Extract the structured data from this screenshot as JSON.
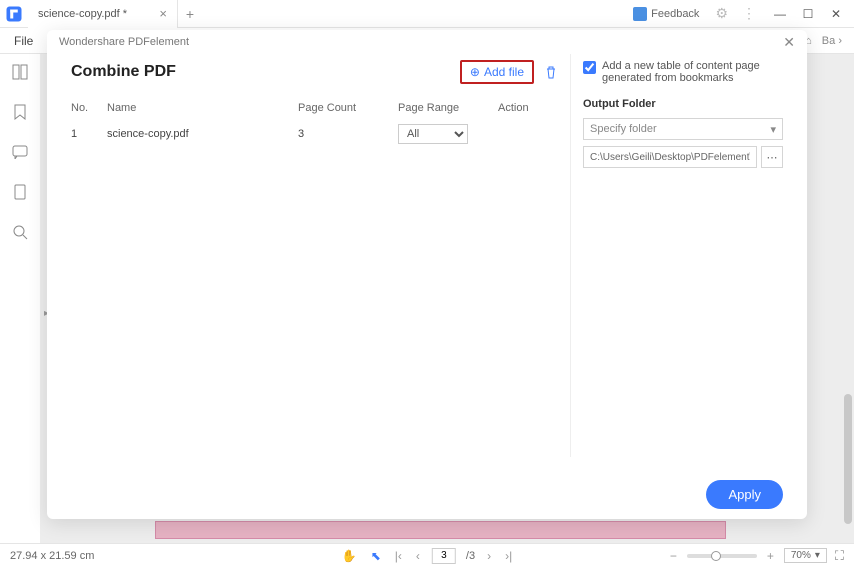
{
  "titlebar": {
    "tab_name": "science-copy.pdf *",
    "feedback_label": "Feedback"
  },
  "menubar": {
    "file": "File",
    "right_label": "Ba"
  },
  "dialog": {
    "app_title": "Wondershare PDFelement",
    "title": "Combine PDF",
    "add_file_label": "Add file",
    "columns": {
      "no": "No.",
      "name": "Name",
      "page_count": "Page Count",
      "page_range": "Page Range",
      "action": "Action"
    },
    "rows": [
      {
        "no": "1",
        "name": "science-copy.pdf",
        "count": "3",
        "range": "All"
      }
    ],
    "checkbox_label": "Add a new table of content page generated from bookmarks",
    "output_folder_label": "Output Folder",
    "folder_placeholder": "Specify folder",
    "output_path": "C:\\Users\\Geili\\Desktop\\PDFelement\\Co",
    "apply_label": "Apply"
  },
  "statusbar": {
    "dimensions": "27.94 x 21.59 cm",
    "page_current": "3",
    "page_total": "/3",
    "zoom_label": "70%"
  }
}
